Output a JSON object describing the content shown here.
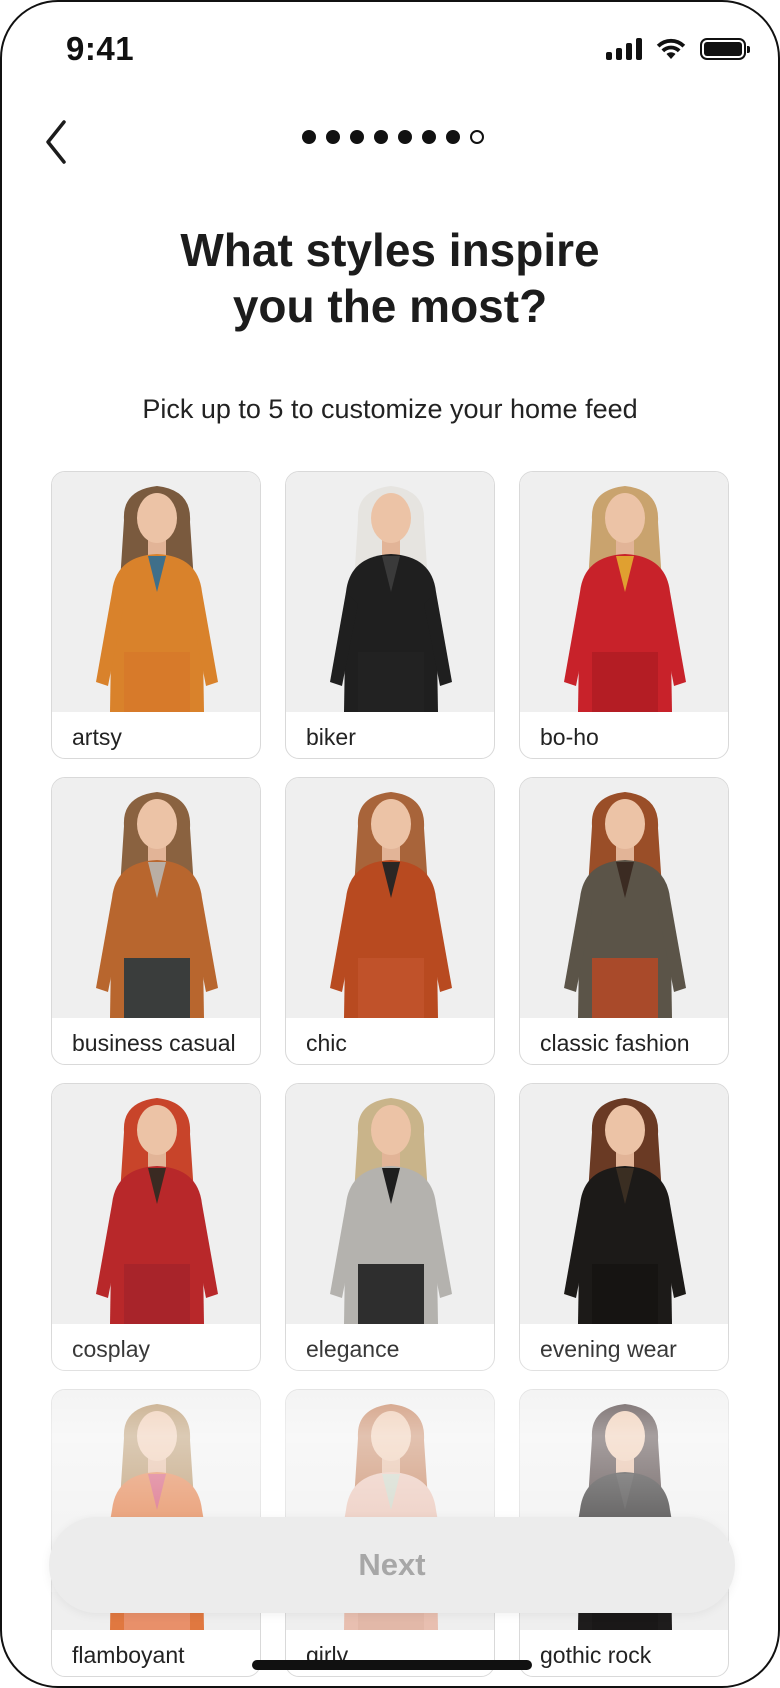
{
  "status_bar": {
    "time": "9:41"
  },
  "progress": {
    "total_steps": 8,
    "current_step": 7
  },
  "title": {
    "line1": "What styles inspire",
    "line2": "you the most?"
  },
  "subtitle": "Pick up to 5 to customize your home feed",
  "styles": [
    {
      "label": "artsy",
      "hair": "#7a5a3e",
      "top": "#d9822b",
      "accent": "#3f6f8a",
      "bottom": "#d77a2a"
    },
    {
      "label": "biker",
      "hair": "#e6e4e0",
      "top": "#1f1f1f",
      "accent": "#3a3a3a",
      "bottom": "#222222"
    },
    {
      "label": "bo-ho",
      "hair": "#c9a36e",
      "top": "#c8222a",
      "accent": "#e0a030",
      "bottom": "#b41d24"
    },
    {
      "label": "business casual",
      "hair": "#8a6240",
      "top": "#b8662e",
      "accent": "#b9aea4",
      "bottom": "#3a3d3c"
    },
    {
      "label": "chic",
      "hair": "#a8643a",
      "top": "#b84a20",
      "accent": "#2b2624",
      "bottom": "#c0522a"
    },
    {
      "label": "classic fashion",
      "hair": "#9a4e28",
      "top": "#5b5448",
      "accent": "#3b2b22",
      "bottom": "#a94a2a"
    },
    {
      "label": "cosplay",
      "hair": "#c8442a",
      "top": "#b8282a",
      "accent": "#3a2a22",
      "bottom": "#a8242a"
    },
    {
      "label": "elegance",
      "hair": "#c9b48a",
      "top": "#b4b2ae",
      "accent": "#1e1e1e",
      "bottom": "#2e2e2e"
    },
    {
      "label": "evening wear",
      "hair": "#6a3a24",
      "top": "#1c1a18",
      "accent": "#3a2e22",
      "bottom": "#161412"
    },
    {
      "label": "flamboyant",
      "hair": "#b08a5a",
      "top": "#e07840",
      "accent": "#d04a6a",
      "bottom": "#e8906a"
    },
    {
      "label": "girly",
      "hair": "#c07850",
      "top": "#e8bfb0",
      "accent": "#c8d0c0",
      "bottom": "#e2b8a8"
    },
    {
      "label": "gothic rock",
      "hair": "#3a2a2a",
      "top": "#1e1c1c",
      "accent": "#2a2828",
      "bottom": "#1a1818"
    }
  ],
  "next_button": {
    "label": "Next"
  }
}
